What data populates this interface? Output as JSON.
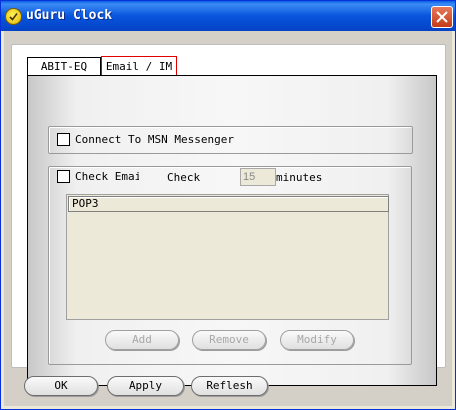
{
  "window": {
    "title": "uGuru Clock"
  },
  "tabs": [
    {
      "label": "ABIT-EQ"
    },
    {
      "label": "Email / IM"
    }
  ],
  "msn": {
    "label": "Connect To MSN Messenger",
    "checked": false
  },
  "email": {
    "check_label": "Check Email",
    "check_every_label": "Check",
    "interval_value": "15",
    "minutes_label": "minutes",
    "checked": false
  },
  "accounts_list": {
    "header": "POP3",
    "items": []
  },
  "list_buttons": {
    "add": "Add",
    "remove": "Remove",
    "modify": "Modify"
  },
  "footer_buttons": {
    "ok": "OK",
    "apply": "Apply",
    "refresh": "Reflesh"
  },
  "colors": {
    "titlebar": "#0855dd",
    "selected_tab_border": "#e00000",
    "close_button": "#c43a17"
  }
}
